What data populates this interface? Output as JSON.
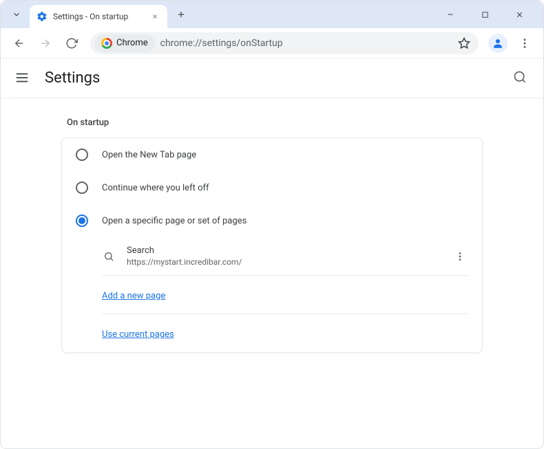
{
  "window": {
    "tab_title": "Settings - On startup"
  },
  "toolbar": {
    "chip_label": "Chrome",
    "url": "chrome://settings/onStartup"
  },
  "header": {
    "title": "Settings"
  },
  "section": {
    "label": "On startup",
    "options": [
      {
        "label": "Open the New Tab page",
        "checked": false
      },
      {
        "label": "Continue where you left off",
        "checked": false
      },
      {
        "label": "Open a specific page or set of pages",
        "checked": true
      }
    ],
    "pages": [
      {
        "title": "Search",
        "url": "https://mystart.incredibar.com/"
      }
    ],
    "add_label": "Add a new page",
    "use_current_label": "Use current pages"
  }
}
